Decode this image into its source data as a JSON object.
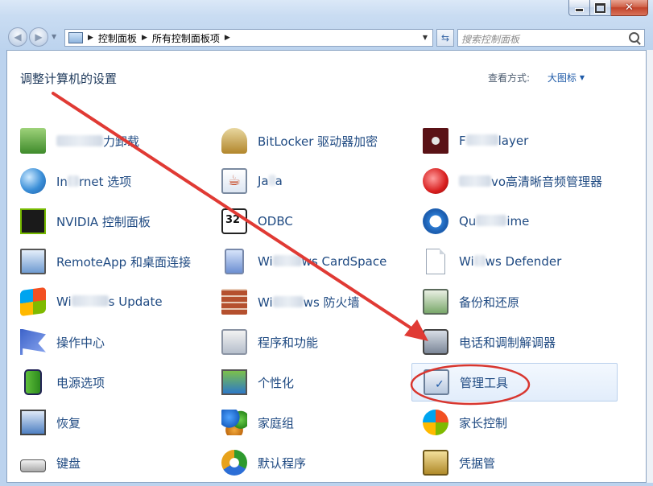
{
  "window": {
    "caption_buttons": {
      "minimize": "minimize-icon",
      "maximize": "maximize-icon",
      "close": "close-icon"
    }
  },
  "nav": {
    "breadcrumb": [
      "控制面板",
      "所有控制面板项"
    ],
    "search_placeholder": "搜索控制面板"
  },
  "header": {
    "title": "调整计算机的设置",
    "view_by_label": "查看方式:",
    "view_by_value": "大图标"
  },
  "items": {
    "col1": [
      {
        "label": "力卸载",
        "masked_prefix": true,
        "icon": "uninstall-icon"
      },
      {
        "label_a": "In",
        "label_b": "rnet 选项",
        "icon": "internet-options-icon"
      },
      {
        "label": "NVIDIA 控制面板",
        "icon": "nvidia-icon"
      },
      {
        "label": "RemoteApp 和桌面连接",
        "icon": "remoteapp-icon"
      },
      {
        "label_a": "Wi",
        "label_b": "s Update",
        "icon": "windows-update-icon"
      },
      {
        "label": "操作中心",
        "icon": "action-center-flag-icon"
      },
      {
        "label": "电源选项",
        "icon": "battery-icon"
      },
      {
        "label": "恢复",
        "icon": "recovery-icon"
      },
      {
        "label": "键盘",
        "icon": "keyboard-icon"
      }
    ],
    "col2": [
      {
        "label": "BitLocker 驱动器加密",
        "icon": "bitlocker-icon"
      },
      {
        "label_a": "Ja",
        "label_b": "a",
        "icon": "java-icon"
      },
      {
        "label": "ODBC",
        "icon": "odbc-icon"
      },
      {
        "label_a": "Wi",
        "label_b": "ws CardSpace",
        "icon": "cardspace-icon"
      },
      {
        "label_a": "Wi",
        "label_b": "ws 防火墙",
        "icon": "firewall-icon"
      },
      {
        "label": "程序和功能",
        "icon": "programs-icon"
      },
      {
        "label": "个性化",
        "icon": "personalization-icon"
      },
      {
        "label": "家庭组",
        "icon": "homegroup-icon"
      },
      {
        "label": "默认程序",
        "icon": "default-programs-icon"
      }
    ],
    "col3": [
      {
        "label_a": "F",
        "label_b": "layer",
        "icon": "flash-player-icon"
      },
      {
        "label_a": "",
        "label_b": "vo高清晰音频管理器",
        "icon": "audio-manager-icon"
      },
      {
        "label_a": "Qu",
        "label_b": "ime",
        "icon": "quicktime-icon"
      },
      {
        "label_a": "Wi",
        "label_b": "ws Defender",
        "icon": "defender-icon"
      },
      {
        "label": "备份和还原",
        "icon": "backup-icon"
      },
      {
        "label": "电话和调制解调器",
        "icon": "phone-modem-icon"
      },
      {
        "label": "管理工具",
        "icon": "admin-tools-icon",
        "highlighted": true
      },
      {
        "label": "家长控制",
        "icon": "parental-controls-icon"
      },
      {
        "label": "凭据管",
        "icon": "credential-manager-icon"
      }
    ]
  },
  "annotation": {
    "arrow_color": "#e03a34",
    "ellipse_color": "#d8362f"
  }
}
